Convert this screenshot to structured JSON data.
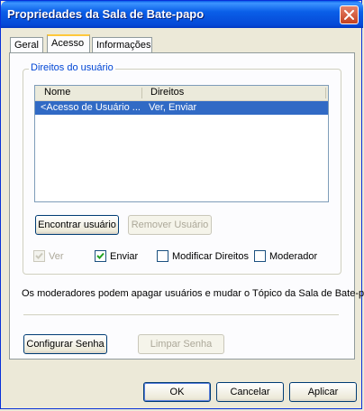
{
  "window": {
    "title": "Propriedades da Sala de Bate-papo",
    "close_label": "×"
  },
  "tabs": [
    {
      "label": "Geral",
      "active": false
    },
    {
      "label": "Acesso",
      "active": true
    },
    {
      "label": "Informações",
      "active": false
    }
  ],
  "user_rights": {
    "group_label": "Direitos do usuário",
    "columns": [
      "Nome",
      "Direitos"
    ],
    "rows": [
      {
        "name": "<Acesso de Usuário ...",
        "rights": "Ver, Enviar",
        "selected": true
      }
    ]
  },
  "buttons": {
    "find_user": "Encontrar usuário",
    "remove_user": "Remover Usuário",
    "set_password": "Configurar Senha",
    "clear_password": "Limpar Senha",
    "ok": "OK",
    "cancel": "Cancelar",
    "apply": "Aplicar"
  },
  "checkboxes": [
    {
      "label": "Ver",
      "checked": true,
      "disabled": true
    },
    {
      "label": "Enviar",
      "checked": true,
      "disabled": false
    },
    {
      "label": "Modificar Direitos",
      "checked": false,
      "disabled": false
    },
    {
      "label": "Moderador",
      "checked": false,
      "disabled": false
    }
  ],
  "note": "Os moderadores podem apagar usuários e mudar o Tópico da Sala de Bate-papo",
  "colors": {
    "title_blue": "#0a5fe8",
    "selection": "#316ac5",
    "group_label": "#0046d5"
  }
}
